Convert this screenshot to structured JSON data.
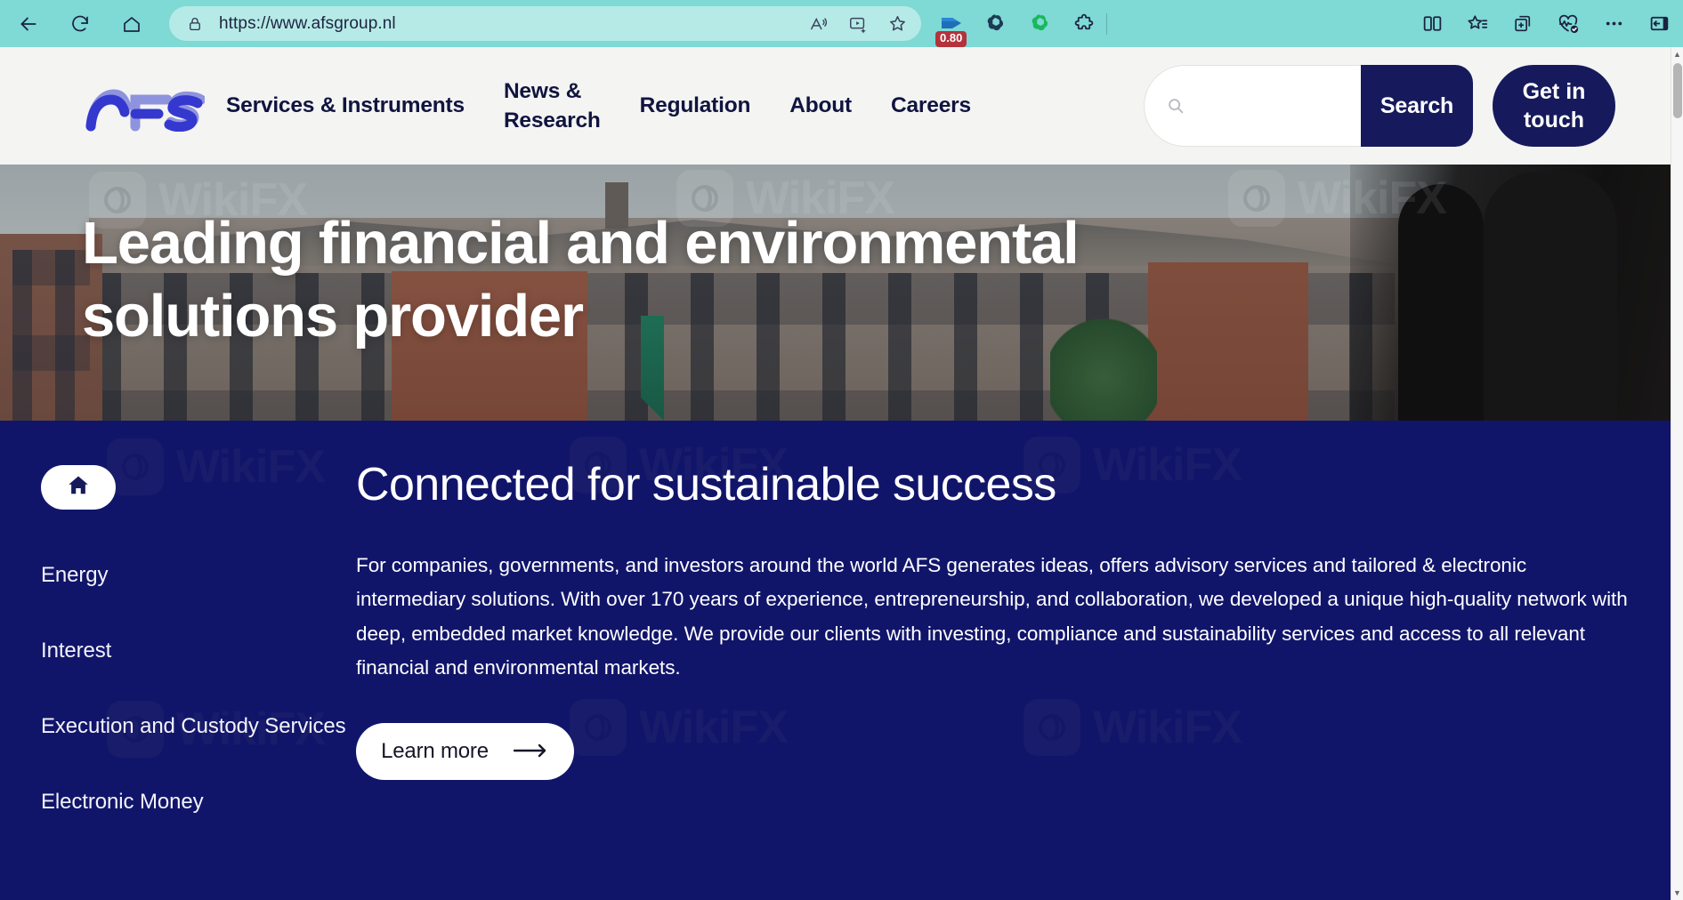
{
  "browser": {
    "url": "https://www.afsgroup.nl",
    "back_label": "Back",
    "refresh_label": "Refresh",
    "home_label": "Home",
    "lock_icon": "lock-icon",
    "read_aloud_label": "Read aloud",
    "media_label": "Media player",
    "favorite_label": "Add this page to favorites",
    "extension_badge": "0.80",
    "extensions": [
      {
        "name": "video-extension",
        "label": "Video downloader"
      },
      {
        "name": "openai-dark-extension",
        "label": "OpenAI"
      },
      {
        "name": "openai-green-extension",
        "label": "ChatGPT"
      },
      {
        "name": "puzzle-extension",
        "label": "Extensions"
      }
    ],
    "split_screen_label": "Split screen",
    "favorites_label": "Favorites",
    "collections_label": "Collections",
    "essentials_label": "Browser essentials",
    "settings_label": "Settings and more",
    "sidebar_label": "Open sidebar"
  },
  "site": {
    "logo_text": "AFS",
    "nav": [
      {
        "label": "Services & Instruments",
        "name": "nav-services-instruments"
      },
      {
        "label": "News &\nResearch",
        "name": "nav-news-research"
      },
      {
        "label": "Regulation",
        "name": "nav-regulation"
      },
      {
        "label": "About",
        "name": "nav-about"
      },
      {
        "label": "Careers",
        "name": "nav-careers"
      }
    ],
    "search": {
      "placeholder": "",
      "value": "",
      "button_label": "Search"
    },
    "cta_label": "Get in touch"
  },
  "hero": {
    "title": "Leading financial and environmental\nsolutions provider"
  },
  "section": {
    "heading": "Connected for sustainable success",
    "body": "For companies, governments, and investors around the world AFS generates ideas, offers advisory services and tailored & electronic intermediary solutions. With over 170 years of experience, entrepreneurship, and collaboration, we developed a unique high-quality network with deep, embedded market knowledge. We provide our clients with investing, compliance and sustainability services and access to all relevant financial and environmental markets.",
    "learn_more_label": "Learn more"
  },
  "sidenav": {
    "home_icon": "home-icon",
    "items": [
      {
        "label": "Energy",
        "name": "sidebar-item-energy"
      },
      {
        "label": "Interest",
        "name": "sidebar-item-interest"
      },
      {
        "label": "Execution and Custody Services",
        "name": "sidebar-item-execution-custody-services"
      },
      {
        "label": "Electronic Money",
        "name": "sidebar-item-electronic-money"
      }
    ]
  },
  "watermark": {
    "text": "WikiFX"
  },
  "colors": {
    "brand_navy": "#161a5c",
    "content_blue": "#11156a",
    "browser_teal": "#7fd9d4",
    "badge_red": "#b4323c",
    "header_grey": "#f4f4f3"
  }
}
